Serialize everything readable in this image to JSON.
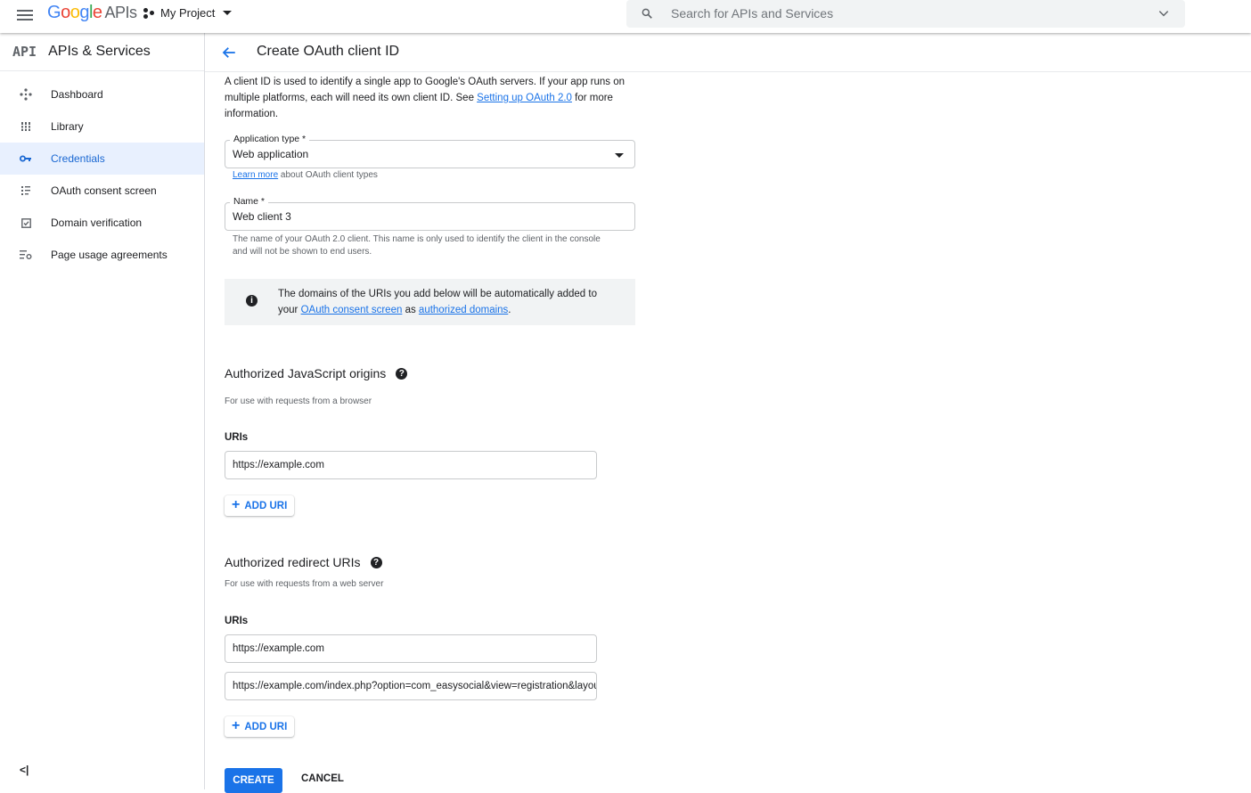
{
  "topbar": {
    "logo": {
      "g": "G",
      "o1": "o",
      "o2": "o",
      "g2": "g",
      "l": "l",
      "e": "e",
      "apis": "APIs"
    },
    "project": "My Project",
    "search_placeholder": "Search for APIs and Services"
  },
  "sidebar": {
    "badge": "API",
    "title": "APIs & Services",
    "items": [
      {
        "label": "Dashboard",
        "icon": "dashboard-icon"
      },
      {
        "label": "Library",
        "icon": "library-icon"
      },
      {
        "label": "Credentials",
        "icon": "key-icon",
        "active": true
      },
      {
        "label": "OAuth consent screen",
        "icon": "consent-icon"
      },
      {
        "label": "Domain verification",
        "icon": "checkbox-icon"
      },
      {
        "label": "Page usage agreements",
        "icon": "settings-list-icon"
      }
    ],
    "collapse": "<|"
  },
  "header": {
    "title": "Create OAuth client ID"
  },
  "intro": {
    "text1": "A client ID is used to identify a single app to Google's OAuth servers. If your app runs on multiple platforms, each will need its own client ID. See ",
    "link": "Setting up OAuth 2.0",
    "text2": " for more information."
  },
  "app_type": {
    "label": "Application type *",
    "value": "Web application",
    "learn_more": "Learn more",
    "hint_rest": " about OAuth client types"
  },
  "name_field": {
    "label": "Name *",
    "value": "Web client 3",
    "hint": "The name of your OAuth 2.0 client. This name is only used to identify the client in the console and will not be shown to end users."
  },
  "info": {
    "text1": "The domains of the URIs you add below will be automatically added to your ",
    "link1": "OAuth consent screen",
    "text2": " as ",
    "link2": "authorized domains",
    "text3": "."
  },
  "js_origins": {
    "title": "Authorized JavaScript origins",
    "sub": "For use with requests from a browser",
    "uris_label": "URIs",
    "uris": [
      "https://example.com"
    ],
    "add": "ADD URI"
  },
  "redirects": {
    "title": "Authorized redirect URIs",
    "sub": "For use with requests from a web server",
    "uris_label": "URIs",
    "uris": [
      "https://example.com",
      "https://example.com/index.php?option=com_easysocial&view=registration&layout=oauthDialog&client=google"
    ],
    "add": "ADD URI"
  },
  "actions": {
    "create": "CREATE",
    "cancel": "CANCEL"
  },
  "colors": {
    "accent": "#1a73e8",
    "active_bg": "#e8f0fe",
    "info_bg": "#f1f3f4"
  }
}
